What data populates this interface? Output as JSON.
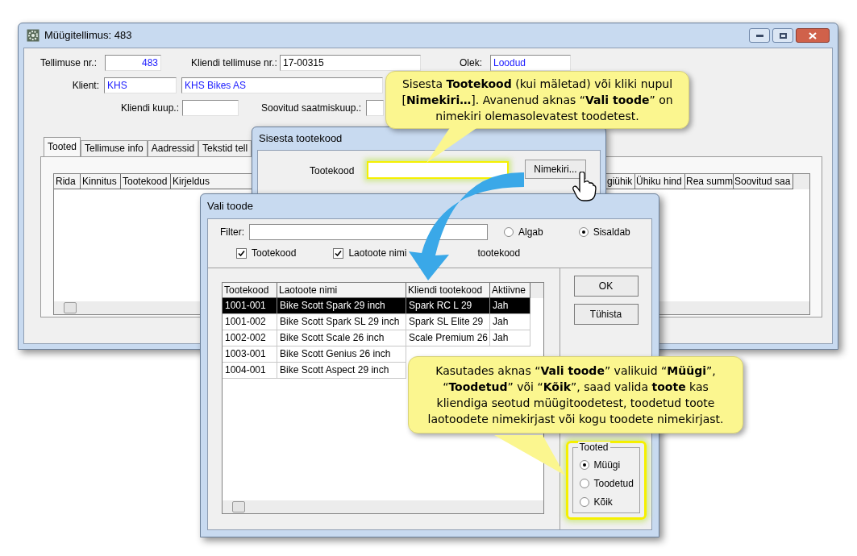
{
  "main_window": {
    "title": "Müügitellimus: 483",
    "fields": {
      "order_no_label": "Tellimuse nr.:",
      "order_no": "483",
      "client_order_label": "Kliendi tellimuse nr.:",
      "client_order": "17-00315",
      "status_label": "Olek:",
      "status": "Loodud",
      "client_label": "Klient:",
      "client_code": "KHS",
      "client_name": "KHS Bikes AS",
      "client_date_label": "Kliendi kuup.:",
      "ship_date_label": "Soovitud saatmiskuup.:"
    },
    "tabs": [
      {
        "label": "Tooted",
        "selected": true
      },
      {
        "label": "Tellimuse info",
        "selected": false
      },
      {
        "label": "Aadressid",
        "selected": false
      },
      {
        "label": "Tekstid tell",
        "selected": false
      }
    ],
    "table_left_columns": [
      "Rida",
      "Kinnitus",
      "Tootekood",
      "Kirjeldus"
    ],
    "table_right_columns": [
      "giühik",
      "Ühiku hind",
      "Rea summ",
      "Soovitud saa"
    ]
  },
  "code_dialog": {
    "title": "Sisesta tootekood",
    "label": "Tootekood",
    "button": "Nimekiri..."
  },
  "select_dialog": {
    "title": "Vali toode",
    "filter_label": "Filter:",
    "match_options": [
      {
        "label": "Algab",
        "selected": false
      },
      {
        "label": "Sisaldab",
        "selected": true
      }
    ],
    "search_in": [
      {
        "kind": "checkbox",
        "label": "Tootekood",
        "checked": true
      },
      {
        "kind": "checkbox",
        "label": "Laotoote nimi",
        "checked": true
      },
      {
        "kind": "label",
        "label": "tootekood"
      }
    ],
    "columns": [
      "Tootekood",
      "Laotoote nimi",
      "Kliendi tootekood",
      "Aktiivne"
    ],
    "rows": [
      {
        "cells": [
          "1001-001",
          "Bike Scott Spark 29 inch",
          "Spark RC L 29",
          "Jah"
        ],
        "selected": true
      },
      {
        "cells": [
          "1001-002",
          "Bike Scott Spark SL 29 inch",
          "Spark SL Elite 29",
          "Jah"
        ],
        "selected": false
      },
      {
        "cells": [
          "1002-002",
          "Bike Scott Scale 26 inch",
          "Scale Premium 26",
          "Jah"
        ],
        "selected": false
      },
      {
        "cells": [
          "1003-001",
          "Bike Scott Genius 26 inch"
        ],
        "selected": false
      },
      {
        "cells": [
          "1004-001",
          "Bike Scott Aspect 29 inch"
        ],
        "selected": false
      }
    ],
    "buttons": [
      "OK",
      "Tühista"
    ],
    "group": {
      "title": "Tooted",
      "options": [
        {
          "label": "Müügi",
          "selected": true
        },
        {
          "label": "Toodetud",
          "selected": false
        },
        {
          "label": "Kõik",
          "selected": false
        }
      ]
    }
  },
  "callouts": [
    {
      "text": "Sisesta **Tootekood** (kui mäletad) või kliki nupul [**Nimekiri…**]. Avanenud aknas “**Vali toode**” on nimekiri olemasolevatest toodetest."
    },
    {
      "text": "Kasutades aknas “**Vali toode**” valikuid “**Müügi**”, “**Toodetud**”  või “**Kõik**”, saad valida **toote** kas kliendiga seotud müügitoodetest, toodetud toote laotoodete nimekirjast või kogu toodete nimekirjast."
    }
  ]
}
